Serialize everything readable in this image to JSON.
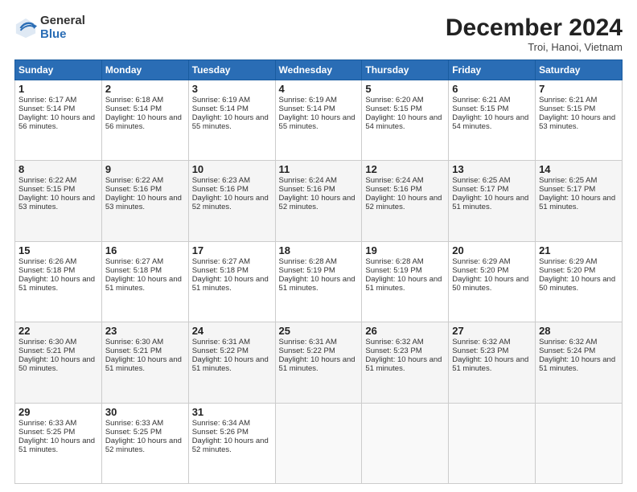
{
  "header": {
    "logo_general": "General",
    "logo_blue": "Blue",
    "month_title": "December 2024",
    "location": "Troi, Hanoi, Vietnam"
  },
  "days_of_week": [
    "Sunday",
    "Monday",
    "Tuesday",
    "Wednesday",
    "Thursday",
    "Friday",
    "Saturday"
  ],
  "weeks": [
    [
      {
        "day": "1",
        "sunrise": "Sunrise: 6:17 AM",
        "sunset": "Sunset: 5:14 PM",
        "daylight": "Daylight: 10 hours and 56 minutes."
      },
      {
        "day": "2",
        "sunrise": "Sunrise: 6:18 AM",
        "sunset": "Sunset: 5:14 PM",
        "daylight": "Daylight: 10 hours and 56 minutes."
      },
      {
        "day": "3",
        "sunrise": "Sunrise: 6:19 AM",
        "sunset": "Sunset: 5:14 PM",
        "daylight": "Daylight: 10 hours and 55 minutes."
      },
      {
        "day": "4",
        "sunrise": "Sunrise: 6:19 AM",
        "sunset": "Sunset: 5:14 PM",
        "daylight": "Daylight: 10 hours and 55 minutes."
      },
      {
        "day": "5",
        "sunrise": "Sunrise: 6:20 AM",
        "sunset": "Sunset: 5:15 PM",
        "daylight": "Daylight: 10 hours and 54 minutes."
      },
      {
        "day": "6",
        "sunrise": "Sunrise: 6:21 AM",
        "sunset": "Sunset: 5:15 PM",
        "daylight": "Daylight: 10 hours and 54 minutes."
      },
      {
        "day": "7",
        "sunrise": "Sunrise: 6:21 AM",
        "sunset": "Sunset: 5:15 PM",
        "daylight": "Daylight: 10 hours and 53 minutes."
      }
    ],
    [
      {
        "day": "8",
        "sunrise": "Sunrise: 6:22 AM",
        "sunset": "Sunset: 5:15 PM",
        "daylight": "Daylight: 10 hours and 53 minutes."
      },
      {
        "day": "9",
        "sunrise": "Sunrise: 6:22 AM",
        "sunset": "Sunset: 5:16 PM",
        "daylight": "Daylight: 10 hours and 53 minutes."
      },
      {
        "day": "10",
        "sunrise": "Sunrise: 6:23 AM",
        "sunset": "Sunset: 5:16 PM",
        "daylight": "Daylight: 10 hours and 52 minutes."
      },
      {
        "day": "11",
        "sunrise": "Sunrise: 6:24 AM",
        "sunset": "Sunset: 5:16 PM",
        "daylight": "Daylight: 10 hours and 52 minutes."
      },
      {
        "day": "12",
        "sunrise": "Sunrise: 6:24 AM",
        "sunset": "Sunset: 5:16 PM",
        "daylight": "Daylight: 10 hours and 52 minutes."
      },
      {
        "day": "13",
        "sunrise": "Sunrise: 6:25 AM",
        "sunset": "Sunset: 5:17 PM",
        "daylight": "Daylight: 10 hours and 51 minutes."
      },
      {
        "day": "14",
        "sunrise": "Sunrise: 6:25 AM",
        "sunset": "Sunset: 5:17 PM",
        "daylight": "Daylight: 10 hours and 51 minutes."
      }
    ],
    [
      {
        "day": "15",
        "sunrise": "Sunrise: 6:26 AM",
        "sunset": "Sunset: 5:18 PM",
        "daylight": "Daylight: 10 hours and 51 minutes."
      },
      {
        "day": "16",
        "sunrise": "Sunrise: 6:27 AM",
        "sunset": "Sunset: 5:18 PM",
        "daylight": "Daylight: 10 hours and 51 minutes."
      },
      {
        "day": "17",
        "sunrise": "Sunrise: 6:27 AM",
        "sunset": "Sunset: 5:18 PM",
        "daylight": "Daylight: 10 hours and 51 minutes."
      },
      {
        "day": "18",
        "sunrise": "Sunrise: 6:28 AM",
        "sunset": "Sunset: 5:19 PM",
        "daylight": "Daylight: 10 hours and 51 minutes."
      },
      {
        "day": "19",
        "sunrise": "Sunrise: 6:28 AM",
        "sunset": "Sunset: 5:19 PM",
        "daylight": "Daylight: 10 hours and 51 minutes."
      },
      {
        "day": "20",
        "sunrise": "Sunrise: 6:29 AM",
        "sunset": "Sunset: 5:20 PM",
        "daylight": "Daylight: 10 hours and 50 minutes."
      },
      {
        "day": "21",
        "sunrise": "Sunrise: 6:29 AM",
        "sunset": "Sunset: 5:20 PM",
        "daylight": "Daylight: 10 hours and 50 minutes."
      }
    ],
    [
      {
        "day": "22",
        "sunrise": "Sunrise: 6:30 AM",
        "sunset": "Sunset: 5:21 PM",
        "daylight": "Daylight: 10 hours and 50 minutes."
      },
      {
        "day": "23",
        "sunrise": "Sunrise: 6:30 AM",
        "sunset": "Sunset: 5:21 PM",
        "daylight": "Daylight: 10 hours and 51 minutes."
      },
      {
        "day": "24",
        "sunrise": "Sunrise: 6:31 AM",
        "sunset": "Sunset: 5:22 PM",
        "daylight": "Daylight: 10 hours and 51 minutes."
      },
      {
        "day": "25",
        "sunrise": "Sunrise: 6:31 AM",
        "sunset": "Sunset: 5:22 PM",
        "daylight": "Daylight: 10 hours and 51 minutes."
      },
      {
        "day": "26",
        "sunrise": "Sunrise: 6:32 AM",
        "sunset": "Sunset: 5:23 PM",
        "daylight": "Daylight: 10 hours and 51 minutes."
      },
      {
        "day": "27",
        "sunrise": "Sunrise: 6:32 AM",
        "sunset": "Sunset: 5:23 PM",
        "daylight": "Daylight: 10 hours and 51 minutes."
      },
      {
        "day": "28",
        "sunrise": "Sunrise: 6:32 AM",
        "sunset": "Sunset: 5:24 PM",
        "daylight": "Daylight: 10 hours and 51 minutes."
      }
    ],
    [
      {
        "day": "29",
        "sunrise": "Sunrise: 6:33 AM",
        "sunset": "Sunset: 5:25 PM",
        "daylight": "Daylight: 10 hours and 51 minutes."
      },
      {
        "day": "30",
        "sunrise": "Sunrise: 6:33 AM",
        "sunset": "Sunset: 5:25 PM",
        "daylight": "Daylight: 10 hours and 52 minutes."
      },
      {
        "day": "31",
        "sunrise": "Sunrise: 6:34 AM",
        "sunset": "Sunset: 5:26 PM",
        "daylight": "Daylight: 10 hours and 52 minutes."
      },
      null,
      null,
      null,
      null
    ]
  ]
}
